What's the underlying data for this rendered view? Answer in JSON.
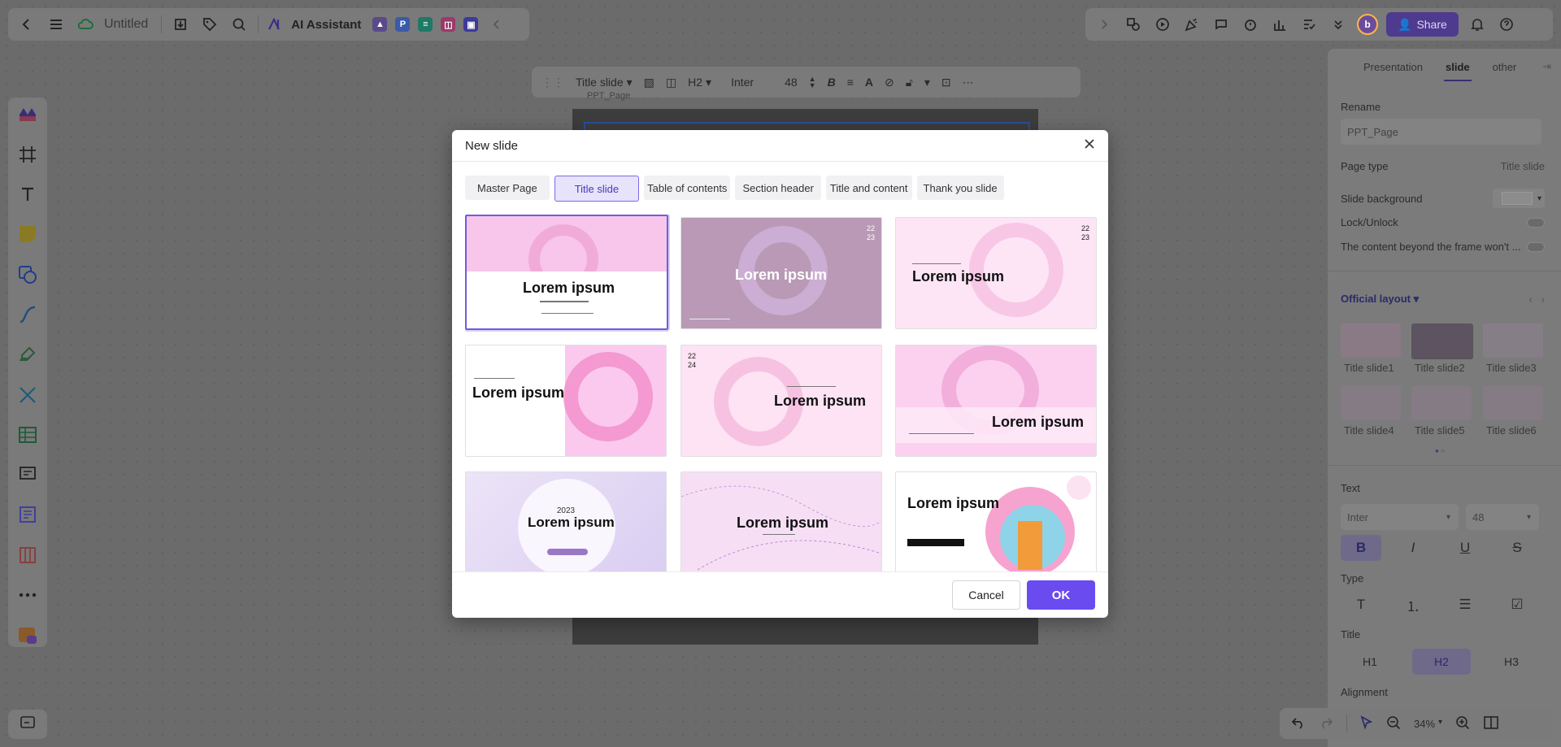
{
  "topbar": {
    "title": "Untitled",
    "ai_label": "AI Assistant",
    "share_label": "Share",
    "avatar_initial": "b"
  },
  "format_bar": {
    "layout_select": "Title slide",
    "heading": "H2",
    "font": "Inter",
    "size": "48"
  },
  "canvas": {
    "slide_name": "PPT_Page"
  },
  "right_panel": {
    "tabs": [
      "Presentation",
      "slide",
      "other"
    ],
    "active_tab": "slide",
    "rename_label": "Rename",
    "rename_value": "PPT_Page",
    "page_type_label": "Page type",
    "page_type_value": "Title slide",
    "background_label": "Slide background",
    "lock_label": "Lock/Unlock",
    "overflow_label": "The content beyond the frame won't ...",
    "layout_label": "Official layout",
    "layouts": [
      "Title slide1",
      "Title slide2",
      "Title slide3",
      "Title slide4",
      "Title slide5",
      "Title slide6"
    ],
    "text_label": "Text",
    "font_value": "Inter",
    "size_value": "48",
    "bold": "B",
    "italic": "I",
    "underline": "U",
    "strike": "S",
    "type_label": "Type",
    "type_text": "T",
    "title_label": "Title",
    "h1": "H1",
    "h2": "H2",
    "h3": "H3",
    "alignment_label": "Alignment"
  },
  "bottom_controls": {
    "zoom": "34%"
  },
  "modal": {
    "title": "New slide",
    "tabs": [
      "Master Page",
      "Title slide",
      "Table of contents",
      "Section header",
      "Title and content",
      "Thank you slide"
    ],
    "active_tab": "Title slide",
    "card_titles": [
      "Lorem ipsum",
      "Lorem ipsum",
      "Lorem ipsum",
      "Lorem ipsum",
      "Lorem ipsum",
      "Lorem ipsum",
      "Lorem ipsum",
      "Lorem ipsum",
      "Lorem ipsum"
    ],
    "card_numbers": {
      "card2": [
        "22",
        "23"
      ],
      "card3": [
        "22",
        "23"
      ],
      "card5": [
        "22",
        "24"
      ],
      "card7": "2023"
    },
    "cancel_label": "Cancel",
    "ok_label": "OK"
  },
  "colors": {
    "accent": "#6a4bf0",
    "selected_border": "#6f5be0",
    "share_bg": "#4e3a8e"
  }
}
